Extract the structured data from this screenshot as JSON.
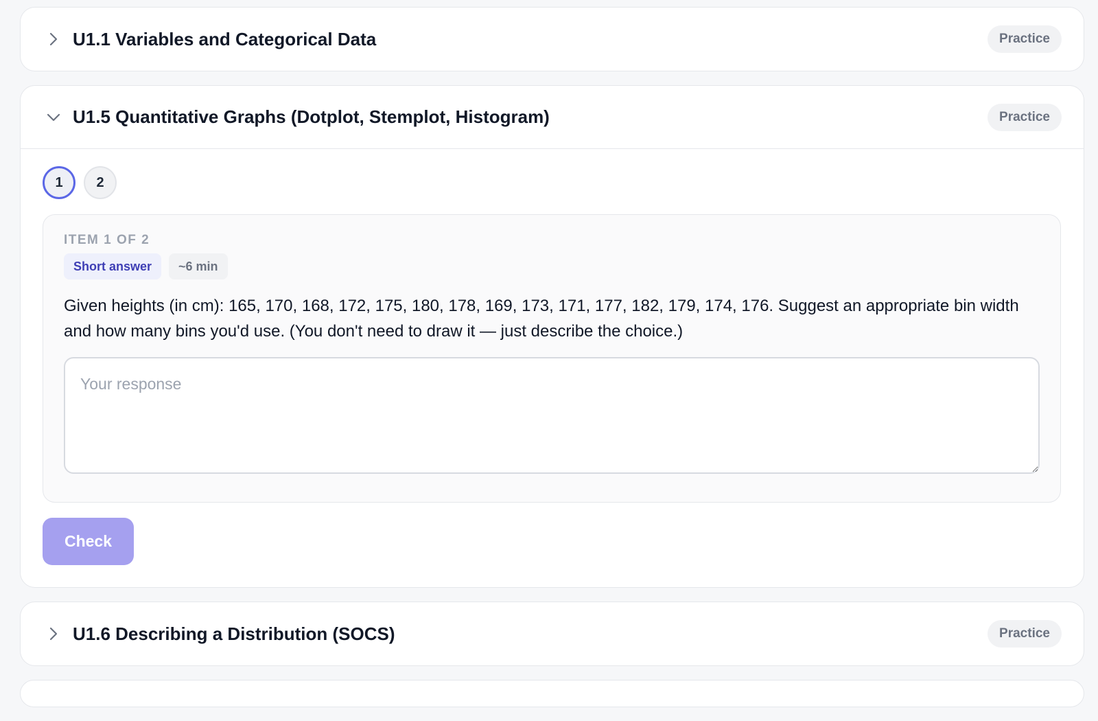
{
  "sections": [
    {
      "title": "U1.1 Variables and Categorical Data",
      "badge": "Practice",
      "expanded": false
    },
    {
      "title": "U1.5 Quantitative Graphs (Dotplot, Stemplot, Histogram)",
      "badge": "Practice",
      "expanded": true
    },
    {
      "title": "U1.6 Describing a Distribution (SOCS)",
      "badge": "Practice",
      "expanded": false
    }
  ],
  "open_section": {
    "steps": [
      "1",
      "2"
    ],
    "active_step": "1",
    "item": {
      "label": "ITEM 1 OF 2",
      "type_tag": "Short answer",
      "time_tag": "~6 min",
      "prompt": "Given heights (in cm): 165, 170, 168, 172, 175, 180, 178, 169, 173, 171, 177, 182, 179, 174, 176. Suggest an appropriate bin width and how many bins you'd use. (You don't need to draw it — just describe the choice.)",
      "response_value": "",
      "response_placeholder": "Your response"
    },
    "check_label": "Check"
  },
  "icons": {
    "collapsed": "chevron-right-icon",
    "expanded": "chevron-down-icon"
  },
  "colors": {
    "accent": "#5b67e6",
    "check_button": "#a5a0ef",
    "type_tag_text": "#3f3fb5"
  }
}
